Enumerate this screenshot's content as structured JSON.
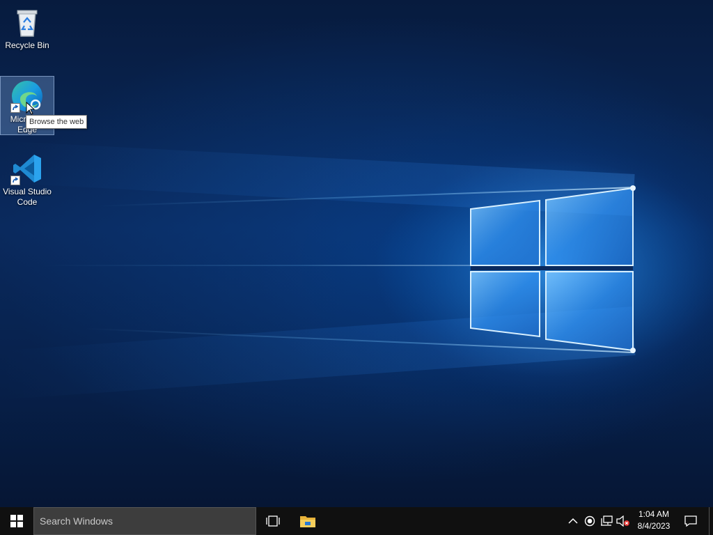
{
  "desktop": {
    "icons": [
      {
        "label": "Recycle Bin",
        "icon": "recycle-bin-icon"
      },
      {
        "label": "Microsoft Edge",
        "icon": "edge-icon",
        "selected": true
      },
      {
        "label": "Visual Studio Code",
        "icon": "vscode-icon"
      }
    ],
    "tooltip": "Browse the web"
  },
  "taskbar": {
    "start_icon": "windows-logo-icon",
    "search_placeholder": "Search Windows",
    "task_view_icon": "task-view-icon",
    "pinned": [
      {
        "name": "File Explorer",
        "icon": "folder-icon"
      }
    ],
    "tray": {
      "icons": [
        "chevron-up-icon",
        "record-icon",
        "network-icon",
        "volume-muted-icon"
      ],
      "time": "1:04 AM",
      "date": "8/4/2023",
      "notification_icon": "action-center-icon"
    }
  },
  "colors": {
    "taskbar_bg": "#101010",
    "search_bg": "#3d3d3d",
    "wallpaper_accent": "#0a78e6"
  }
}
